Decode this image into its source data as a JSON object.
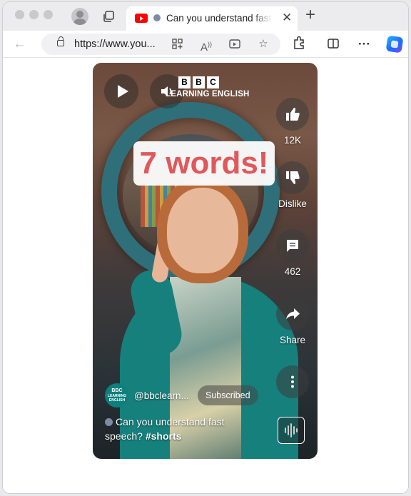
{
  "browser": {
    "tab": {
      "title": "Can you understand fast speech? #shorts",
      "icon": "youtube-icon"
    },
    "url_prefix": "https://",
    "url_host": "www.you...",
    "buttons": [
      "back",
      "tabs",
      "new-tab",
      "extensions",
      "split-screen",
      "more",
      "copilot"
    ]
  },
  "video": {
    "brand_letters": [
      "B",
      "B",
      "C"
    ],
    "brand_text": "LEARNING ENGLISH",
    "caption_overlay": "7 words!",
    "like_count": "12K",
    "dislike_label": "Dislike",
    "comment_count": "462",
    "share_label": "Share",
    "channel": {
      "name": "@bbclearn...",
      "avatar_lines": [
        "BBC",
        "LEARNING",
        "ENGLISH"
      ],
      "subscribe_state": "Subscribed"
    },
    "description": "Can you understand fast speech?",
    "hashtag": "#shorts"
  },
  "colors": {
    "caption_text": "#e0585b",
    "youtube_red": "#ff0000",
    "channel_teal": "#0f7f7c"
  }
}
